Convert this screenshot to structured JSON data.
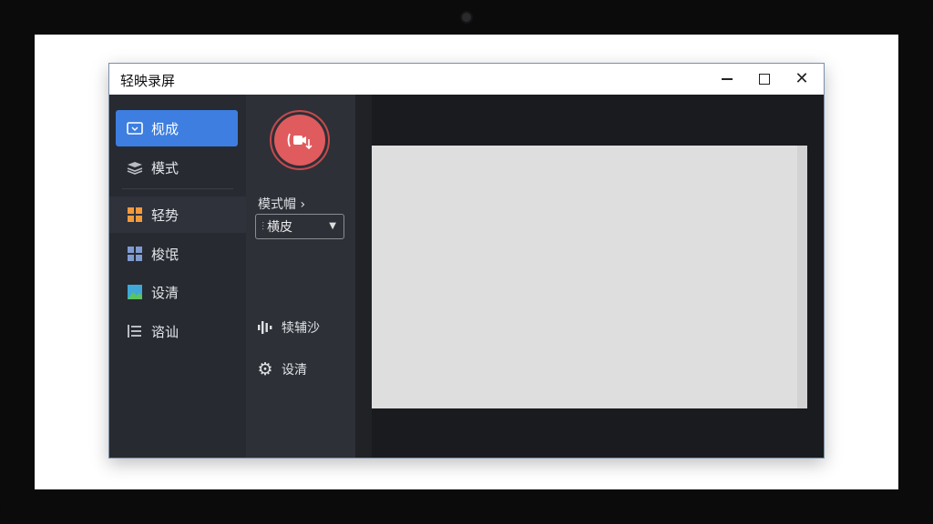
{
  "window": {
    "title": "轻映录屏"
  },
  "sidebar": {
    "items": [
      {
        "label": "枧成",
        "icon": "screen-icon",
        "active": true
      },
      {
        "label": "模式",
        "icon": "layers-icon"
      },
      {
        "label": "轻势",
        "icon": "grid-orange-icon"
      },
      {
        "label": "梭氓",
        "icon": "grid-blue-icon"
      },
      {
        "label": "设清",
        "icon": "image-icon"
      },
      {
        "label": "谘讪",
        "icon": "list-icon"
      }
    ]
  },
  "controls": {
    "record_icon": "record-camera-icon",
    "mode_label": "模式帽 ›",
    "mode_select_value": "横皮",
    "row1_label": "犊辅沙",
    "row1_icon": "audio-waveform-icon",
    "row2_label": "设清",
    "row2_icon": "gear-icon"
  },
  "colors": {
    "accent": "#3d7ee0",
    "record": "#e05b5e",
    "sidebar_bg": "#272a31",
    "panel_bg": "#2d3037",
    "preview_bg": "#1a1b1e",
    "canvas_bg": "#dedede"
  }
}
